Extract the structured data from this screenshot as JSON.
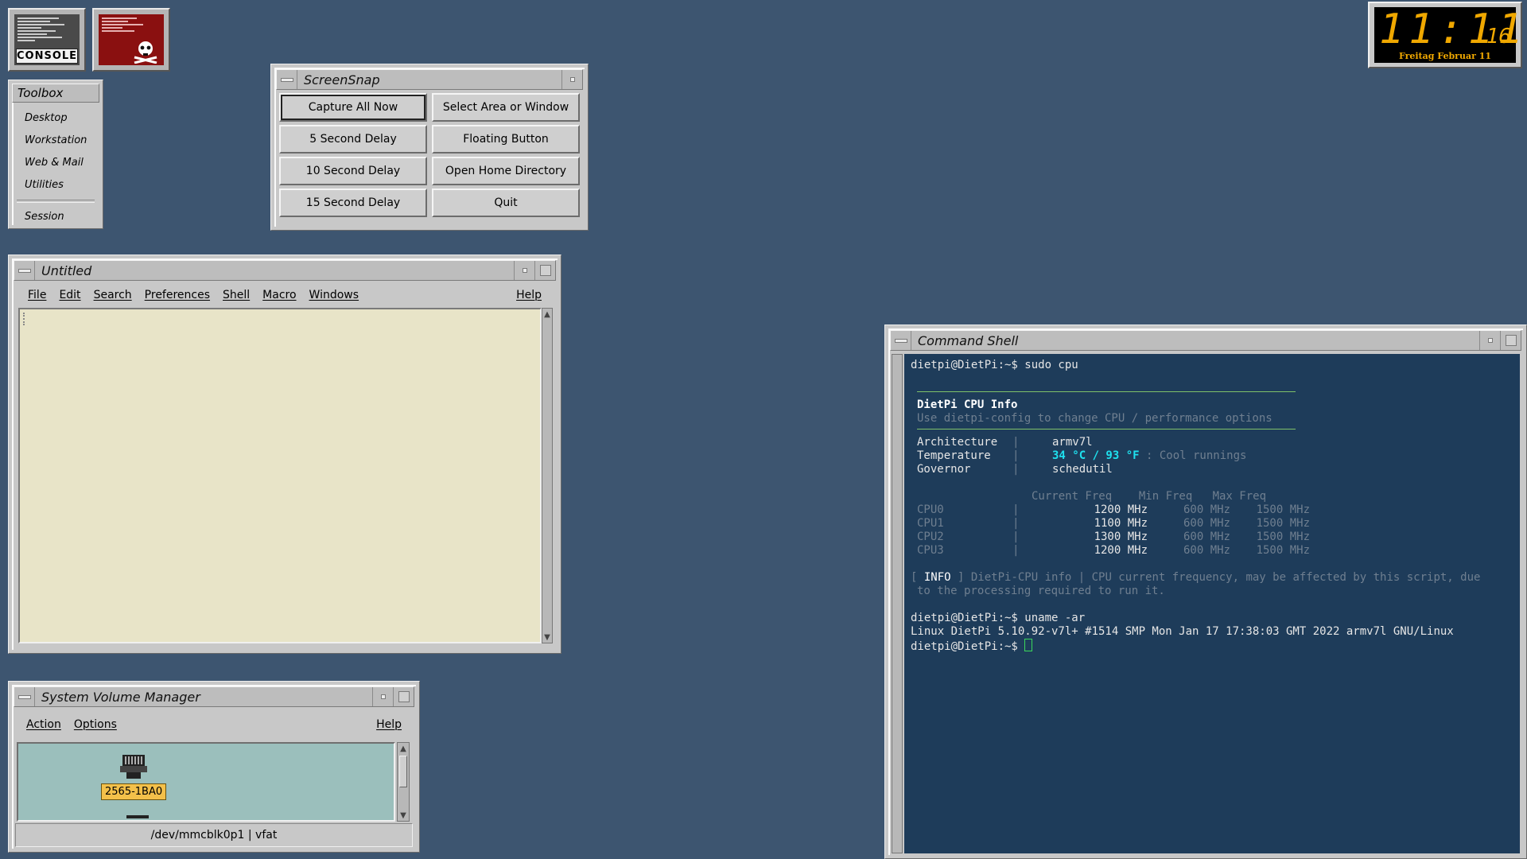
{
  "desktop_icons": {
    "console_label": "CONSOLE",
    "kill_icon": "skull-crossbones-icon"
  },
  "toolbox": {
    "title": "Toolbox",
    "items": [
      "Desktop",
      "Workstation",
      "Web & Mail",
      "Utilities"
    ],
    "session": "Session"
  },
  "screensnap": {
    "title": "ScreenSnap",
    "buttons": [
      "Capture All Now",
      "Select Area or Window",
      "5 Second Delay",
      "Floating Button",
      "10 Second Delay",
      "Open Home Directory",
      "15 Second Delay",
      "Quit"
    ]
  },
  "editor": {
    "title": "Untitled",
    "menu": [
      "File",
      "Edit",
      "Search",
      "Preferences",
      "Shell",
      "Macro",
      "Windows"
    ],
    "help": "Help"
  },
  "volume_manager": {
    "title": "System Volume Manager",
    "menu": [
      "Action",
      "Options"
    ],
    "help": "Help",
    "drive_label": "2565-1BA0",
    "status": "/dev/mmcblk0p1 | vfat"
  },
  "shell": {
    "title": "Command Shell",
    "prompt1": "dietpi@DietPi:~$ sudo cpu",
    "info_title": "DietPi CPU Info",
    "info_sub": "Use dietpi-config to change CPU / performance options",
    "arch_label": "Architecture",
    "arch_value": "armv7l",
    "temp_label": "Temperature",
    "temp_value": "34 °C / 93 °F",
    "temp_note": " : Cool runnings",
    "gov_label": "Governor",
    "gov_value": "schedutil",
    "freq_header": "Current Freq    Min Freq   Max Freq",
    "cpus": [
      {
        "name": "CPU0",
        "cur": "1200 MHz",
        "min": "600 MHz",
        "max": "1500 MHz"
      },
      {
        "name": "CPU1",
        "cur": "1100 MHz",
        "min": "600 MHz",
        "max": "1500 MHz"
      },
      {
        "name": "CPU2",
        "cur": "1300 MHz",
        "min": "600 MHz",
        "max": "1500 MHz"
      },
      {
        "name": "CPU3",
        "cur": "1200 MHz",
        "min": "600 MHz",
        "max": "1500 MHz"
      }
    ],
    "info_tag": "INFO",
    "info_line1": " ] DietPi-CPU info | CPU current frequency, may be affected by this script, due",
    "info_line2": "to the processing required to run it.",
    "prompt2": "dietpi@DietPi:~$ uname -ar",
    "uname_out": "Linux DietPi 5.10.92-v7l+ #1514 SMP Mon Jan 17 17:38:03 GMT 2022 armv7l GNU/Linux",
    "prompt3": "dietpi@DietPi:~$ "
  },
  "clock": {
    "time": "11:11",
    "seconds": "16",
    "date": "Freitag Februar 11"
  },
  "colors": {
    "desktop": "#3d5570",
    "terminal_bg": "#1e3c5a",
    "terminal_cyan": "#1ee0ee",
    "clock_amber": "#f0a800",
    "editor_bg": "#e8e4c8",
    "volume_bg": "#9bbfbc"
  }
}
